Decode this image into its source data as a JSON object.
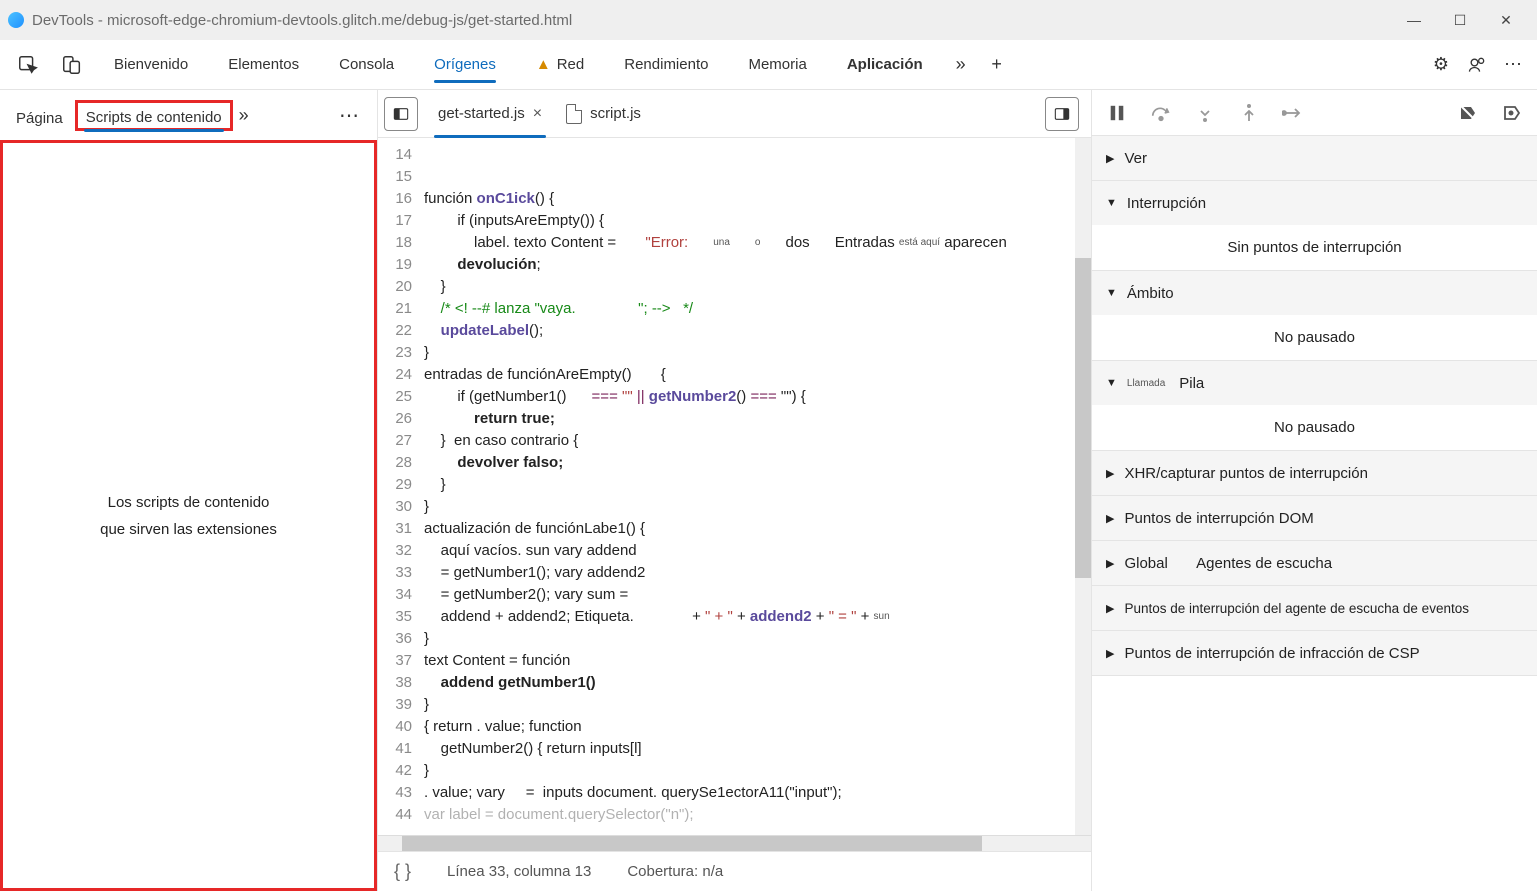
{
  "window": {
    "title": "DevTools - microsoft-edge-chromium-devtools.glitch.me/debug-js/get-started.html"
  },
  "main_tabs": {
    "welcome": "Bienvenido",
    "elements": "Elementos",
    "console": "Consola",
    "sources": "Orígenes",
    "network": "Red",
    "performance": "Rendimiento",
    "memory": "Memoria",
    "application": "Aplicación"
  },
  "left": {
    "page": "Página",
    "content_scripts": "Scripts de contenido",
    "empty_l1": "Los scripts de contenido",
    "empty_l2": "que sirven las extensiones"
  },
  "files": {
    "active": "get-started.js",
    "other": "script.js"
  },
  "gutter": {
    "start": 14,
    "end": 44
  },
  "code": {
    "l14": "",
    "l15_a": "función ",
    "l15_b": "onC1ick",
    "l15_c": "() {",
    "l16": "        if (inputsAreEmpty()) {",
    "l17_a": "            label. texto Content =       ",
    "l17_b": "\"Error:",
    "l17_c": "una",
    "l17_d": "o",
    "l17_e": "dos      Entradas ",
    "l17_f": "está aquí",
    "l17_g": "aparecen",
    "l18_a": "        ",
    "l18_b": "devolución",
    "l19": "    }",
    "l20_a": "    /* <! --# lanza \"vaya.",
    "l20_b": "\"; -->   */",
    "l21_a": "    ",
    "l21_b": "updateLabel",
    "l21_c": "();",
    "l22": "}",
    "l23": "entradas de funciónAreEmpty()       {",
    "l24_a": "        if (getNumber1()      ",
    "l24_b": "===",
    "l24_c": " \"\" ",
    "l24_d": "||",
    "l24_e": " getNumber2",
    "l24_f": "() ",
    "l24_g": "===",
    "l24_h": " \"\") {",
    "l25_a": "            ",
    "l25_b": "return true;",
    "l26": "    }  en caso contrario {",
    "l27_a": "        ",
    "l27_b": "devolver falso;",
    "l28": "    }",
    "l29": "}",
    "l30": "actualización de funciónLabe1() {",
    "l31": "    aquí vacíos. sun vary addend",
    "l32": "    = getNumber1(); vary addend2",
    "l33": "    = getNumber2(); vary sum =",
    "l34_a": "    addend + addend2; Etiqueta.              + ",
    "l34_b": "\" + \"",
    "l34_c": " + ",
    "l34_d": "addend2",
    "l34_e": " + ",
    "l34_f": "\" = \"",
    "l34_g": " + ",
    "l34_h": "sun",
    "l35": "}",
    "l36": "text Content = función",
    "l37_a": "    ",
    "l37_b": "addend getNumber1()",
    "l38": "}",
    "l39": "{ return . value; function",
    "l40": "    getNumber2() { return inputs[l]",
    "l41": "}",
    "l42": ". value; vary     =  inputs document. querySe1ectorA11(\"input\");",
    "l43": "var label = document.querySelector(\"n\");"
  },
  "status": {
    "pos": "Línea 33, columna 13",
    "cov": "Cobertura: n/a"
  },
  "right": {
    "watch": "Ver",
    "breakpoints": "Interrupción",
    "nobp": "Sin puntos de interrupción",
    "scope": "Ámbito",
    "nopaused": "No pausado",
    "callstack_pre": "Llamada",
    "callstack": "Pila",
    "nopaused2": "No pausado",
    "xhr": "XHR/capturar puntos de interrupción",
    "dom": "Puntos de interrupción DOM",
    "global": "Global",
    "listeners": "Agentes de escucha",
    "eventbp": "Puntos de interrupción del agente de escucha de eventos",
    "csp": "Puntos de interrupción de infracción de CSP"
  }
}
